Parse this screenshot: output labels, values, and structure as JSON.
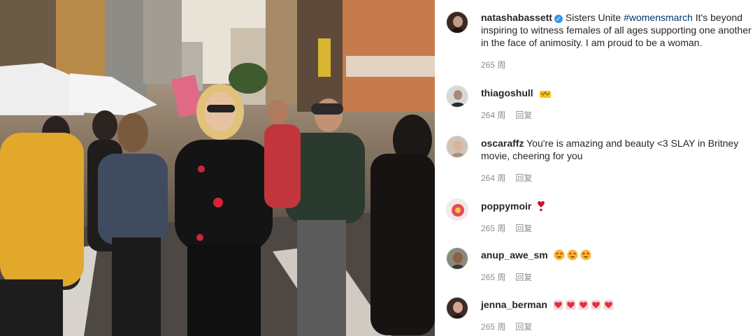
{
  "post": {
    "author": "natashabassett",
    "caption_lead": "Sisters Unite ",
    "hashtag": "#womensmarch",
    "caption_rest": " It's beyond inspiring to witness females of all ages supporting one another in the face of animosity. I am proud to be a woman.",
    "time": "265 周"
  },
  "reply_label": "回复",
  "comments": [
    {
      "user": "thiagoshull",
      "text": "",
      "time": "264 周",
      "emoji": "crown-icon"
    },
    {
      "user": "oscaraffz",
      "text": "You're is amazing and beauty <3 SLAY in Britney movie, cheering for you",
      "time": "264 周"
    },
    {
      "user": "poppymoir",
      "text": "",
      "time": "265 周",
      "emoji": "exclamation-heart-icon"
    },
    {
      "user": "anup_awe_sm",
      "text": "",
      "time": "265 周",
      "emoji": "heart-eyes-icon"
    },
    {
      "user": "jenna_berman",
      "text": "",
      "time": "265 周",
      "emoji": "red-heart-icon"
    }
  ],
  "colors": {
    "link": "#00376b",
    "verified": "#3897f0",
    "muted": "#8e8e8e",
    "heart": "#ed4956"
  }
}
